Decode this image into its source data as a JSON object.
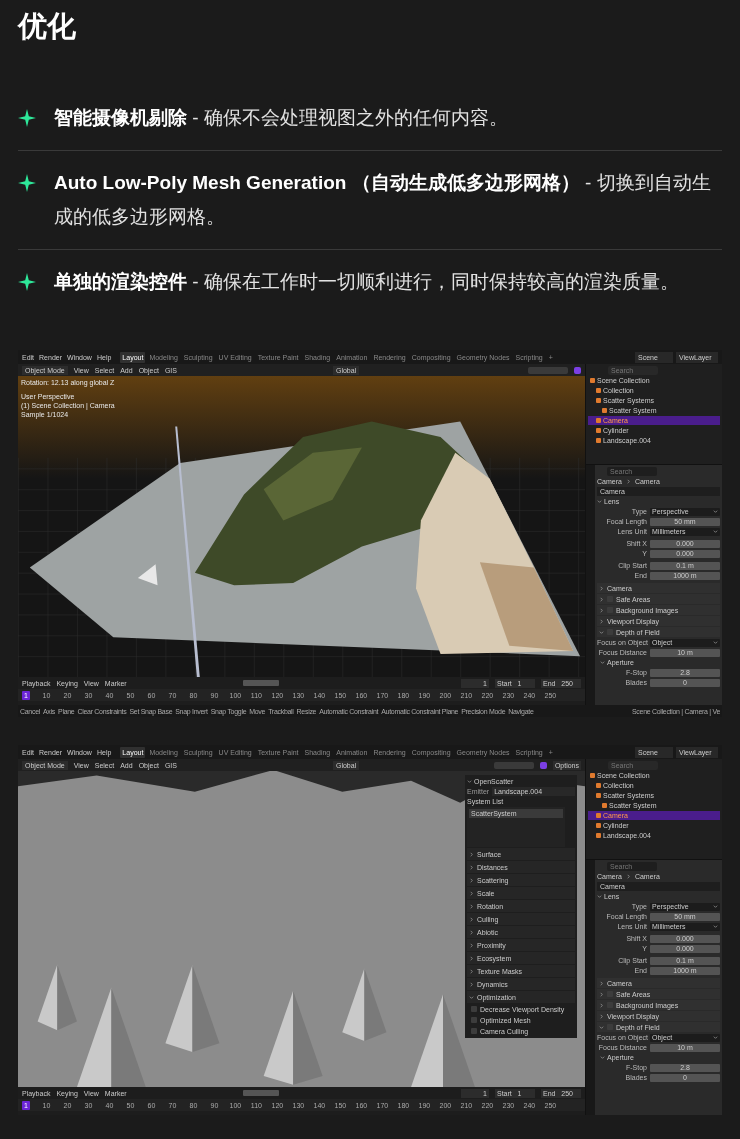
{
  "title": "优化",
  "features": [
    {
      "text": "**智能摄像机剔除** - 确保不会处理视图之外的任何内容。"
    },
    {
      "text": "**Auto Low-Poly Mesh Generation （自动生成低多边形网格）** - 切换到自动生成的低多边形网格。"
    },
    {
      "text": "**单独的渲染控件** - 确保在工作时一切顺利进行，同时保持较高的渲染质量。"
    }
  ],
  "screenshots": [
    {
      "menu": [
        "Edit",
        "Render",
        "Window",
        "Help"
      ],
      "workspaces": [
        {
          "label": "Layout",
          "selected": true
        },
        {
          "label": "Modeling",
          "selected": false
        },
        {
          "label": "Sculpting",
          "selected": false
        },
        {
          "label": "UV Editing",
          "selected": false
        },
        {
          "label": "Texture Paint",
          "selected": false
        },
        {
          "label": "Shading",
          "selected": false
        },
        {
          "label": "Animation",
          "selected": false
        },
        {
          "label": "Rendering",
          "selected": false
        },
        {
          "label": "Compositing",
          "selected": false
        },
        {
          "label": "Geometry Nodes",
          "selected": false
        },
        {
          "label": "Scripting",
          "selected": false
        }
      ],
      "add_tab": "+",
      "scene": "Scene",
      "view_layer": "ViewLayer",
      "mode": "Object Mode",
      "view_menus": [
        "View",
        "Select",
        "Add",
        "Object",
        "GIS"
      ],
      "orientation": "Global",
      "viewport": {
        "kind": "terrain"
      },
      "overlay": [
        "Rotation: 12.13 along global Z",
        "User Perspective",
        "(1) Scene Collection | Camera",
        "Sample 1/1024"
      ],
      "outliner": {
        "search": "Search",
        "items": [
          {
            "label": "Scene Collection",
            "selected": false,
            "children": [
              {
                "label": "Collection",
                "selected": false
              },
              {
                "label": "Scatter Systems",
                "selected": false,
                "children": [
                  {
                    "label": "Scatter System",
                    "selected": false
                  }
                ]
              },
              {
                "label": "Camera",
                "selected": true
              },
              {
                "label": "Cylinder",
                "selected": false
              },
              {
                "label": "Landscape.004",
                "selected": false
              }
            ]
          }
        ]
      },
      "properties": {
        "search": "Search",
        "path": [
          "Camera",
          "Camera"
        ],
        "datablock": "Camera",
        "section": "Lens",
        "groups": [
          [
            {
              "label": "Type",
              "value": "Perspective",
              "kind": "dropdown"
            },
            {
              "label": "Focal Length",
              "value": "50 mm",
              "kind": "number"
            },
            {
              "label": "Lens Unit",
              "value": "Millimeters",
              "kind": "dropdown"
            }
          ],
          [
            {
              "label": "Shift X",
              "value": "0.000",
              "kind": "number"
            },
            {
              "label": "Y",
              "value": "0.000",
              "kind": "number"
            }
          ],
          [
            {
              "label": "Clip Start",
              "value": "0.1 m",
              "kind": "number"
            },
            {
              "label": "End",
              "value": "1000 m",
              "kind": "number"
            }
          ]
        ],
        "panels": [
          {
            "label": "Camera",
            "expanded": false
          },
          {
            "label": "Safe Areas",
            "expanded": false,
            "checked": false
          },
          {
            "label": "Background Images",
            "expanded": false,
            "checked": false
          },
          {
            "label": "Viewport Display",
            "expanded": false
          },
          {
            "label": "Depth of Field",
            "expanded": true,
            "checked": false
          }
        ],
        "dof": [
          {
            "label": "Focus on Object",
            "value": "Object",
            "kind": "dropdown"
          },
          {
            "label": "Focus Distance",
            "value": "10 m",
            "kind": "number"
          }
        ],
        "subsection": "Aperture",
        "aperture": [
          {
            "label": "F-Stop",
            "value": "2.8",
            "kind": "number"
          },
          {
            "label": "Blades",
            "value": "0",
            "kind": "number"
          }
        ]
      },
      "timeline": {
        "menus": [
          "Playback",
          "Keying",
          "View",
          "Marker"
        ],
        "frame": "1",
        "start_label": "Start",
        "start": "1",
        "end_label": "End",
        "end": "250",
        "playhead": "1",
        "ticks": [
          "10",
          "20",
          "30",
          "40",
          "50",
          "60",
          "70",
          "80",
          "90",
          "100",
          "110",
          "120",
          "130",
          "140",
          "150",
          "160",
          "170",
          "180",
          "190",
          "200",
          "210",
          "220",
          "230",
          "240",
          "250"
        ]
      },
      "status_bar": {
        "items": [
          "Cancel",
          "Axis",
          "Plane",
          "Clear Constraints",
          "Set Snap Base",
          "Snap Invert",
          "Snap Toggle",
          "Move",
          "Trackball",
          "Resize",
          "Automatic Constraint",
          "Automatic Constraint Plane",
          "Precision Mode",
          "Navigate"
        ],
        "right": "Scene Collection | Camera | Ve"
      }
    },
    {
      "menu": [
        "Edit",
        "Render",
        "Window",
        "Help"
      ],
      "workspaces": [
        {
          "label": "Layout",
          "selected": true
        },
        {
          "label": "Modeling",
          "selected": false
        },
        {
          "label": "Sculpting",
          "selected": false
        },
        {
          "label": "UV Editing",
          "selected": false
        },
        {
          "label": "Texture Paint",
          "selected": false
        },
        {
          "label": "Shading",
          "selected": false
        },
        {
          "label": "Animation",
          "selected": false
        },
        {
          "label": "Rendering",
          "selected": false
        },
        {
          "label": "Compositing",
          "selected": false
        },
        {
          "label": "Geometry Nodes",
          "selected": false
        },
        {
          "label": "Scripting",
          "selected": false
        }
      ],
      "add_tab": "+",
      "scene": "Scene",
      "view_layer": "ViewLayer",
      "mode": "Object Mode",
      "view_menus": [
        "View",
        "Select",
        "Add",
        "Object",
        "GIS"
      ],
      "orientation": "Global",
      "viewport": {
        "kind": "forest"
      },
      "options": "Options",
      "scatter_panel": {
        "title": "OpenScatter",
        "emitter_label": "Emitter",
        "emitter": "Landscape.004",
        "list_title": "System List",
        "systems": [
          {
            "label": "ScatterSystem",
            "selected": true
          }
        ],
        "sections": [
          {
            "label": "Surface",
            "expanded": false
          },
          {
            "label": "Distances",
            "expanded": false
          },
          {
            "label": "Scattering",
            "expanded": false
          },
          {
            "label": "Scale",
            "expanded": false
          },
          {
            "label": "Rotation",
            "expanded": false
          },
          {
            "label": "Culling",
            "expanded": false
          },
          {
            "label": "Abiotic",
            "expanded": false
          },
          {
            "label": "Proximity",
            "expanded": false
          },
          {
            "label": "Ecosystem",
            "expanded": false
          },
          {
            "label": "Texture Masks",
            "expanded": false
          },
          {
            "label": "Dynamics",
            "expanded": false
          },
          {
            "label": "Optimization",
            "expanded": true
          }
        ],
        "options": [
          {
            "label": "Decrease Viewport Density",
            "checked": false
          },
          {
            "label": "Optimized Mesh",
            "checked": false
          },
          {
            "label": "Camera Culling",
            "checked": false
          }
        ]
      },
      "outliner": {
        "search": "Search",
        "items": [
          {
            "label": "Scene Collection",
            "selected": false,
            "children": [
              {
                "label": "Collection",
                "selected": false
              },
              {
                "label": "Scatter Systems",
                "selected": false,
                "children": [
                  {
                    "label": "Scatter System",
                    "selected": false
                  }
                ]
              },
              {
                "label": "Camera",
                "selected": true
              },
              {
                "label": "Cylinder",
                "selected": false
              },
              {
                "label": "Landscape.004",
                "selected": false
              }
            ]
          }
        ]
      },
      "properties": {
        "search": "Search",
        "path": [
          "Camera",
          "Camera"
        ],
        "datablock": "Camera",
        "section": "Lens",
        "groups": [
          [
            {
              "label": "Type",
              "value": "Perspective",
              "kind": "dropdown"
            },
            {
              "label": "Focal Length",
              "value": "50 mm",
              "kind": "number"
            },
            {
              "label": "Lens Unit",
              "value": "Millimeters",
              "kind": "dropdown"
            }
          ],
          [
            {
              "label": "Shift X",
              "value": "0.000",
              "kind": "number"
            },
            {
              "label": "Y",
              "value": "0.000",
              "kind": "number"
            }
          ],
          [
            {
              "label": "Clip Start",
              "value": "0.1 m",
              "kind": "number"
            },
            {
              "label": "End",
              "value": "1000 m",
              "kind": "number"
            }
          ]
        ],
        "panels": [
          {
            "label": "Camera",
            "expanded": false
          },
          {
            "label": "Safe Areas",
            "expanded": false,
            "checked": false
          },
          {
            "label": "Background Images",
            "expanded": false,
            "checked": false
          },
          {
            "label": "Viewport Display",
            "expanded": false
          },
          {
            "label": "Depth of Field",
            "expanded": true,
            "checked": false
          }
        ],
        "dof": [
          {
            "label": "Focus on Object",
            "value": "Object",
            "kind": "dropdown"
          },
          {
            "label": "Focus Distance",
            "value": "10 m",
            "kind": "number"
          }
        ],
        "subsection": "Aperture",
        "aperture": [
          {
            "label": "F-Stop",
            "value": "2.8",
            "kind": "number"
          },
          {
            "label": "Blades",
            "value": "0",
            "kind": "number"
          }
        ]
      },
      "timeline": {
        "menus": [
          "Playback",
          "Keying",
          "View",
          "Marker"
        ],
        "frame": "1",
        "start_label": "Start",
        "start": "1",
        "end_label": "End",
        "end": "250",
        "playhead": "1",
        "ticks": [
          "10",
          "20",
          "30",
          "40",
          "50",
          "60",
          "70",
          "80",
          "90",
          "100",
          "110",
          "120",
          "130",
          "140",
          "150",
          "160",
          "170",
          "180",
          "190",
          "200",
          "210",
          "220",
          "230",
          "240",
          "250"
        ]
      }
    }
  ]
}
